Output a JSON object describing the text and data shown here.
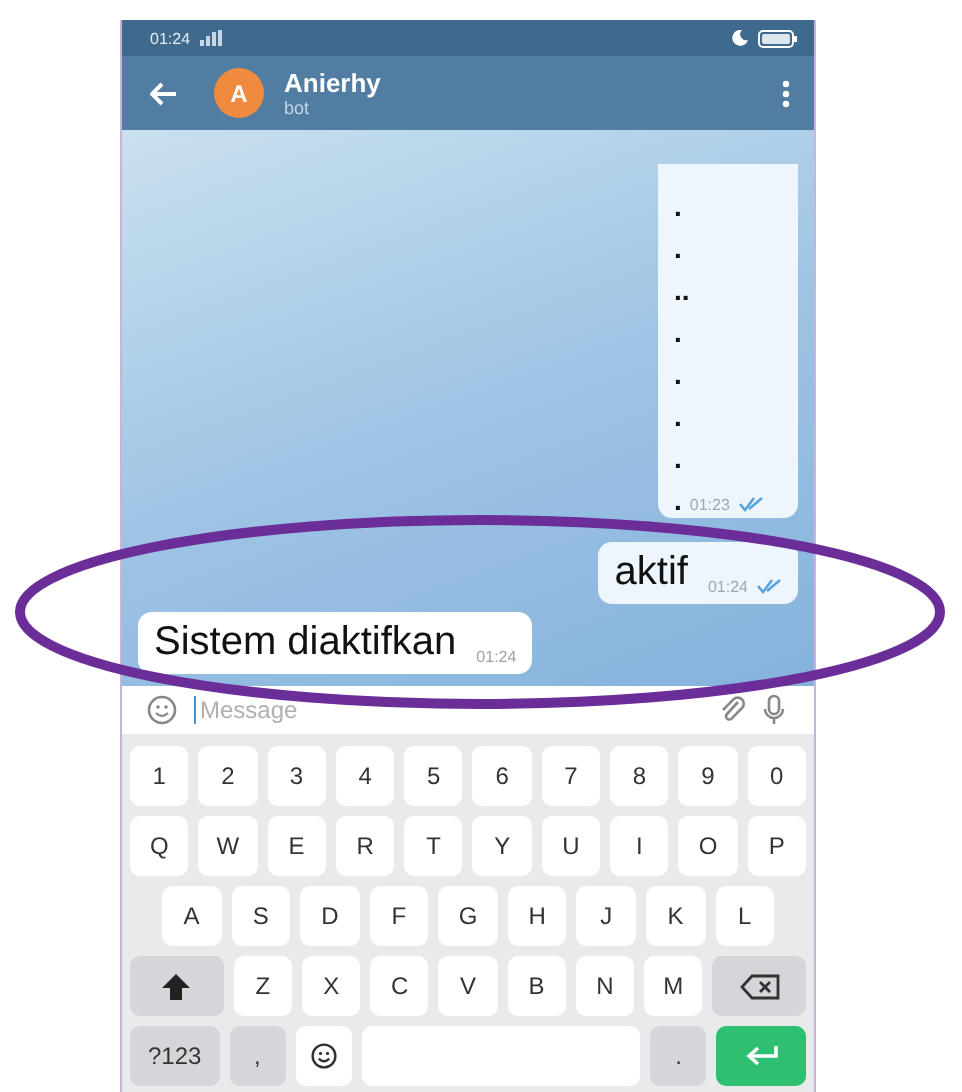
{
  "status_bar": {
    "time": "01:24"
  },
  "header": {
    "avatar_letter": "A",
    "name": "Anierhy",
    "subtitle": "bot"
  },
  "messages": [
    {
      "kind": "outgoing",
      "lines": [
        ".",
        ".",
        "..",
        ".",
        ".",
        ".",
        ".",
        "."
      ],
      "time": "01:23",
      "read": true
    },
    {
      "kind": "outgoing",
      "lines": [
        "aktif"
      ],
      "time": "01:24",
      "read": true
    },
    {
      "kind": "incoming",
      "lines": [
        "Sistem diaktifkan"
      ],
      "time": "01:24"
    }
  ],
  "composer": {
    "placeholder": "Message"
  },
  "keyboard": {
    "rows": [
      [
        {
          "kind": "key",
          "label": "1"
        },
        {
          "kind": "key",
          "label": "2"
        },
        {
          "kind": "key",
          "label": "3"
        },
        {
          "kind": "key",
          "label": "4"
        },
        {
          "kind": "key",
          "label": "5"
        },
        {
          "kind": "key",
          "label": "6"
        },
        {
          "kind": "key",
          "label": "7"
        },
        {
          "kind": "key",
          "label": "8"
        },
        {
          "kind": "key",
          "label": "9"
        },
        {
          "kind": "key",
          "label": "0"
        }
      ],
      [
        {
          "kind": "key",
          "label": "Q"
        },
        {
          "kind": "key",
          "label": "W"
        },
        {
          "kind": "key",
          "label": "E"
        },
        {
          "kind": "key",
          "label": "R"
        },
        {
          "kind": "key",
          "label": "T"
        },
        {
          "kind": "key",
          "label": "Y"
        },
        {
          "kind": "key",
          "label": "U"
        },
        {
          "kind": "key",
          "label": "I"
        },
        {
          "kind": "key",
          "label": "O"
        },
        {
          "kind": "key",
          "label": "P"
        }
      ],
      [
        {
          "kind": "key",
          "label": "A"
        },
        {
          "kind": "key",
          "label": "S"
        },
        {
          "kind": "key",
          "label": "D"
        },
        {
          "kind": "key",
          "label": "F"
        },
        {
          "kind": "key",
          "label": "G"
        },
        {
          "kind": "key",
          "label": "H"
        },
        {
          "kind": "key",
          "label": "J"
        },
        {
          "kind": "key",
          "label": "K"
        },
        {
          "kind": "key",
          "label": "L"
        }
      ],
      [
        {
          "kind": "shift"
        },
        {
          "kind": "key",
          "label": "Z"
        },
        {
          "kind": "key",
          "label": "X"
        },
        {
          "kind": "key",
          "label": "C"
        },
        {
          "kind": "key",
          "label": "V"
        },
        {
          "kind": "key",
          "label": "B"
        },
        {
          "kind": "key",
          "label": "N"
        },
        {
          "kind": "key",
          "label": "M"
        },
        {
          "kind": "backspace"
        }
      ],
      [
        {
          "kind": "fn",
          "label": "?123"
        },
        {
          "kind": "fn",
          "label": ","
        },
        {
          "kind": "emoji"
        },
        {
          "kind": "space"
        },
        {
          "kind": "fn",
          "label": "."
        },
        {
          "kind": "enter"
        }
      ]
    ]
  }
}
